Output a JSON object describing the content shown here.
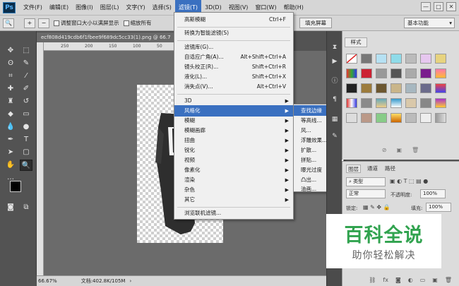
{
  "menubar": {
    "logo": "Ps",
    "items": [
      "文件(F)",
      "编辑(E)",
      "图像(I)",
      "图层(L)",
      "文字(Y)",
      "选择(S)",
      "滤镜(T)",
      "3D(D)",
      "视图(V)",
      "窗口(W)",
      "帮助(H)"
    ],
    "active_index": 6,
    "window_controls": [
      "—",
      "□",
      "✕"
    ]
  },
  "options": {
    "resize_windows_label": "调整窗口大小以满屏显示",
    "zoom_all_label": "缩放所有",
    "fill_screen_label": "填充屏幕",
    "workspace_label": "基本功能"
  },
  "document": {
    "tab_title": "ecf808d419cdb6f1fbee9f689dc5cc33(1).png @ 66.7",
    "ruler_ticks": [
      "250",
      "200",
      "150",
      "100",
      "50"
    ],
    "zoom": "66.67%",
    "doc_info": "文档:402.8K/105M"
  },
  "filter_menu": {
    "items": [
      {
        "label": "高斯模糊",
        "shortcut": "Ctrl+F"
      },
      {
        "label": "转换为智能滤镜(S)",
        "shortcut": ""
      },
      {
        "label": "滤镜库(G)...",
        "shortcut": ""
      },
      {
        "label": "自适应广角(A)...",
        "shortcut": "Alt+Shift+Ctrl+A"
      },
      {
        "label": "镜头校正(R)...",
        "shortcut": "Shift+Ctrl+R"
      },
      {
        "label": "液化(L)...",
        "shortcut": "Shift+Ctrl+X"
      },
      {
        "label": "消失点(V)...",
        "shortcut": "Alt+Ctrl+V"
      },
      {
        "label": "3D",
        "shortcut": ""
      },
      {
        "label": "风格化",
        "shortcut": ""
      },
      {
        "label": "模糊",
        "shortcut": ""
      },
      {
        "label": "模糊画廊",
        "shortcut": ""
      },
      {
        "label": "扭曲",
        "shortcut": ""
      },
      {
        "label": "锐化",
        "shortcut": ""
      },
      {
        "label": "视频",
        "shortcut": ""
      },
      {
        "label": "像素化",
        "shortcut": ""
      },
      {
        "label": "渲染",
        "shortcut": ""
      },
      {
        "label": "杂色",
        "shortcut": ""
      },
      {
        "label": "其它",
        "shortcut": ""
      },
      {
        "label": "浏览联机滤镜...",
        "shortcut": ""
      }
    ]
  },
  "stylize_submenu": {
    "items": [
      "查找边缘",
      "等高线...",
      "风...",
      "浮雕效果...",
      "扩散...",
      "拼贴...",
      "曝光过度",
      "凸出...",
      "油画..."
    ]
  },
  "styles_panel": {
    "tab": "样式"
  },
  "layers_panel": {
    "tabs": [
      "图层",
      "通道",
      "路径"
    ],
    "filter_kind": "类型",
    "blend_mode": "正常",
    "opacity_label": "不透明度:",
    "opacity_value": "100%",
    "lock_label": "锁定:",
    "fill_label": "填充:",
    "fill_value": "100%"
  },
  "watermark": {
    "title": "百科全说",
    "subtitle": "助你轻松解决"
  },
  "colors": {
    "highlight": "#3a70c0",
    "brand_green": "#31a34f"
  }
}
